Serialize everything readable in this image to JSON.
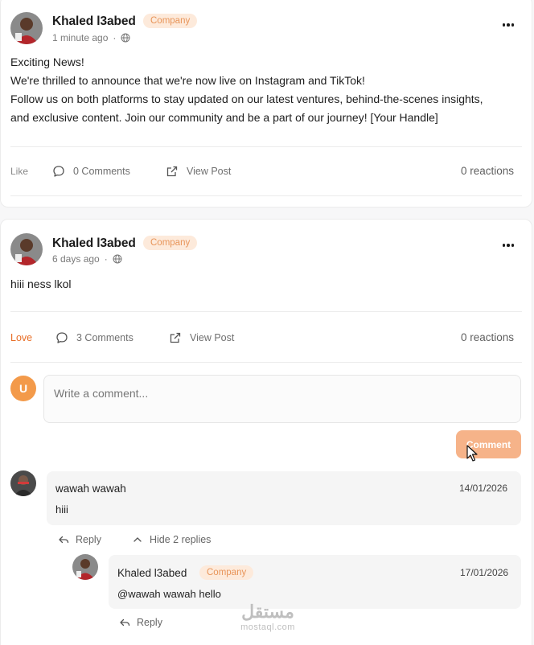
{
  "posts": [
    {
      "author": "Khaled l3abed",
      "badge": "Company",
      "time": "1 minute ago",
      "lines": [
        "Exciting News!",
        "We're thrilled to announce that we're now live on Instagram and TikTok!",
        "Follow us on both platforms to stay updated on our latest ventures, behind-the-scenes insights,",
        "and exclusive content. Join our community and be a part of our journey! [Your Handle]"
      ],
      "reaction_label": "Like",
      "comments_label": "0 Comments",
      "view_post_label": "View Post",
      "reactions": "0 reactions"
    },
    {
      "author": "Khaled l3abed",
      "badge": "Company",
      "time": "6 days ago",
      "lines": [
        "hiii ness lkol"
      ],
      "reaction_label": "Love",
      "comments_label": "3 Comments",
      "view_post_label": "View Post",
      "reactions": "0 reactions",
      "composer": {
        "avatar_initial": "U",
        "placeholder": "Write a comment...",
        "submit_label": "Comment"
      },
      "comments": [
        {
          "author": "wawah wawah",
          "date": "14/01/2026",
          "text": "hiii",
          "reply_label": "Reply",
          "toggle_label": "Hide 2 replies",
          "replies": [
            {
              "author": "Khaled l3abed",
              "badge": "Company",
              "date": "17/01/2026",
              "text": "@wawah wawah hello",
              "reply_label": "Reply"
            }
          ]
        }
      ]
    }
  ],
  "watermark": {
    "logo": "مستقل",
    "site": "mostaql.com"
  },
  "colors": {
    "accent": "#f39a4a",
    "badge_text": "#e8955a",
    "badge_bg": "#fdeadb",
    "love": "#e86d25",
    "button": "#f6b389"
  },
  "icons": [
    "globe-icon",
    "more-icon",
    "comment-icon",
    "external-link-icon",
    "reply-icon",
    "chevron-up-icon"
  ]
}
